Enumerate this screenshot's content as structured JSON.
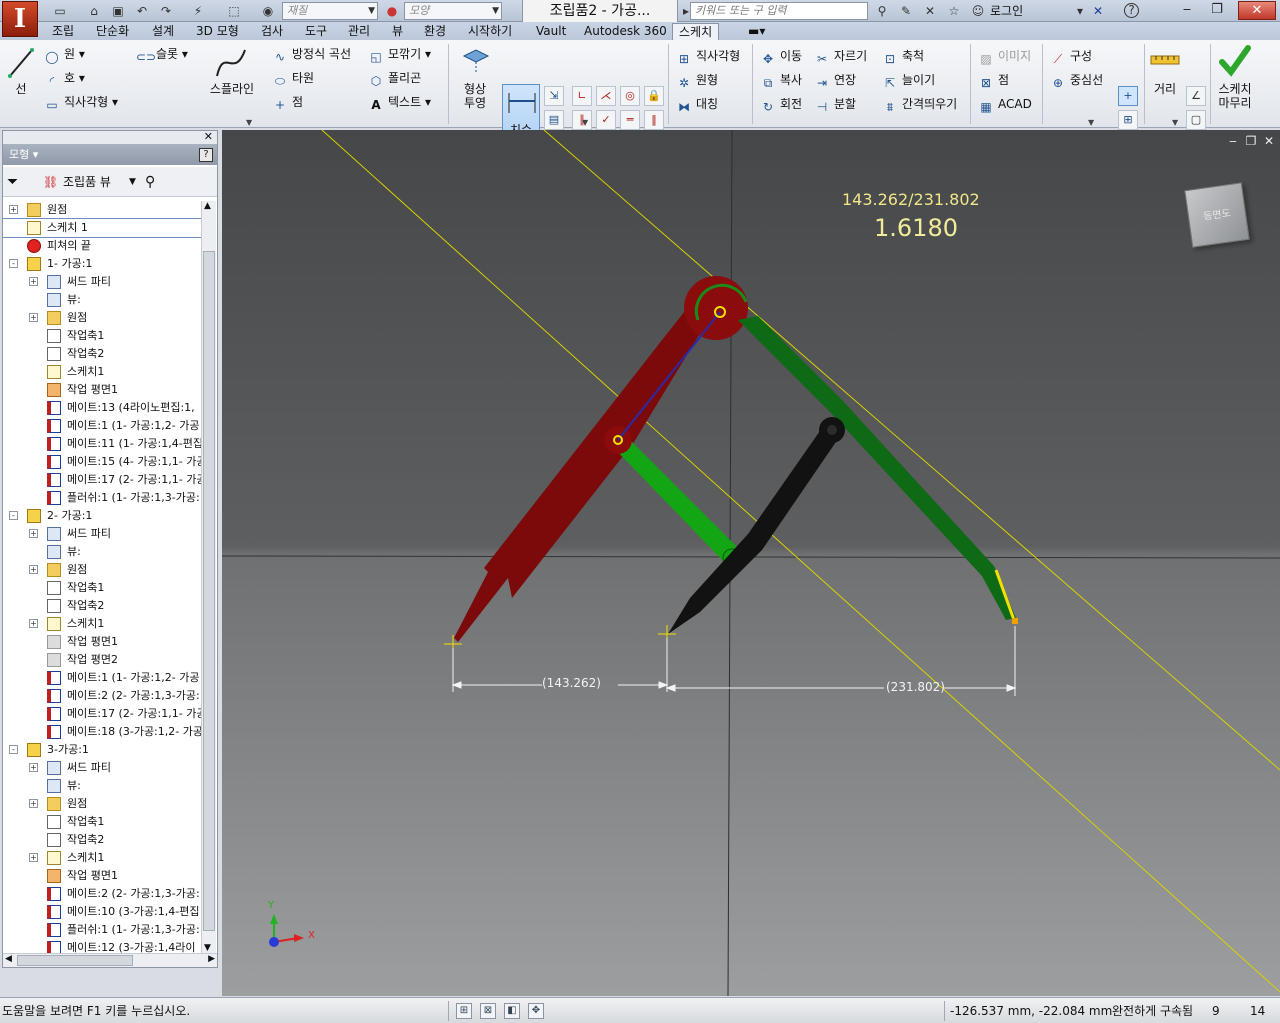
{
  "app": {
    "logo": "I",
    "doc_title": "조립품2 - 가공...",
    "material_placeholder": "재질",
    "appearance_placeholder": "모양",
    "search_placeholder": "키워드 또는 구 입력",
    "signin": "로그인",
    "help": "?"
  },
  "menu_tabs": [
    "조립",
    "단순화",
    "설계",
    "3D 모형",
    "검사",
    "도구",
    "관리",
    "뷰",
    "환경",
    "시작하기",
    "Vault",
    "Autodesk 360",
    "스케치"
  ],
  "ribbon": {
    "line": "선",
    "circle": "원",
    "arc": "호",
    "rectangle": "직사각형",
    "slot": "슬롯",
    "spline": "스플라인",
    "equation_curve": "방정식 곡선",
    "ellipse": "타원",
    "point": "점",
    "fillet": "모깎기",
    "polygon": "폴리곤",
    "text": "텍스트",
    "project": "형상\n투영",
    "dimension": "치수",
    "rect_pattern": "직사각형",
    "circ_pattern": "원형",
    "mirror": "대칭",
    "move": "이동",
    "copy": "복사",
    "rotate": "회전",
    "trim": "자르기",
    "extend": "연장",
    "split": "분할",
    "scale": "축척",
    "stretch": "늘이기",
    "offset": "간격띄우기",
    "image": "이미지",
    "points": "점",
    "acad": "ACAD",
    "construction": "구성",
    "centerline": "중심선",
    "distance": "거리",
    "finish_sketch": "스케치\n마무리"
  },
  "browser": {
    "title": "모형",
    "view": "조립품 뷰",
    "nodes": [
      {
        "label": "원점",
        "indent": 0,
        "icon": "folder",
        "expand": "+"
      },
      {
        "label": "스케치 1",
        "indent": 0,
        "icon": "sketch",
        "expand": "",
        "selected": true
      },
      {
        "label": "피쳐의 끝",
        "indent": 0,
        "icon": "end",
        "expand": ""
      },
      {
        "label": "1- 가공:1",
        "indent": 0,
        "icon": "part",
        "expand": "-"
      },
      {
        "label": "써드 파티",
        "indent": 1,
        "icon": "view",
        "expand": "+"
      },
      {
        "label": "뷰:",
        "indent": 1,
        "icon": "view",
        "expand": ""
      },
      {
        "label": "원점",
        "indent": 1,
        "icon": "folder",
        "expand": "+"
      },
      {
        "label": "작업축1",
        "indent": 1,
        "icon": "axis",
        "expand": ""
      },
      {
        "label": "작업축2",
        "indent": 1,
        "icon": "axis",
        "expand": ""
      },
      {
        "label": "스케치1",
        "indent": 1,
        "icon": "sketch",
        "expand": ""
      },
      {
        "label": "작업 평면1",
        "indent": 1,
        "icon": "plane",
        "expand": ""
      },
      {
        "label": "메이트:13 (4라이노편집:1,",
        "indent": 1,
        "icon": "mate",
        "expand": ""
      },
      {
        "label": "메이트:1 (1- 가공:1,2- 가공",
        "indent": 1,
        "icon": "mate",
        "expand": ""
      },
      {
        "label": "메이트:11 (1- 가공:1,4-편집",
        "indent": 1,
        "icon": "mate",
        "expand": ""
      },
      {
        "label": "메이트:15 (4- 가공:1,1- 가공",
        "indent": 1,
        "icon": "mate",
        "expand": ""
      },
      {
        "label": "메이트:17 (2- 가공:1,1- 가공",
        "indent": 1,
        "icon": "mate",
        "expand": ""
      },
      {
        "label": "플러쉬:1 (1- 가공:1,3-가공:",
        "indent": 1,
        "icon": "mate",
        "expand": ""
      },
      {
        "label": "2- 가공:1",
        "indent": 0,
        "icon": "part",
        "expand": "-"
      },
      {
        "label": "써드 파티",
        "indent": 1,
        "icon": "view",
        "expand": "+"
      },
      {
        "label": "뷰:",
        "indent": 1,
        "icon": "view",
        "expand": ""
      },
      {
        "label": "원점",
        "indent": 1,
        "icon": "folder",
        "expand": "+"
      },
      {
        "label": "작업축1",
        "indent": 1,
        "icon": "axis",
        "expand": ""
      },
      {
        "label": "작업축2",
        "indent": 1,
        "icon": "axis",
        "expand": ""
      },
      {
        "label": "스케치1",
        "indent": 1,
        "icon": "sketch",
        "expand": "+"
      },
      {
        "label": "작업 평면1",
        "indent": 1,
        "icon": "plane-g",
        "expand": ""
      },
      {
        "label": "작업 평면2",
        "indent": 1,
        "icon": "plane-g",
        "expand": ""
      },
      {
        "label": "메이트:1 (1- 가공:1,2- 가공",
        "indent": 1,
        "icon": "mate",
        "expand": ""
      },
      {
        "label": "메이트:2 (2- 가공:1,3-가공:",
        "indent": 1,
        "icon": "mate",
        "expand": ""
      },
      {
        "label": "메이트:17 (2- 가공:1,1- 가공",
        "indent": 1,
        "icon": "mate",
        "expand": ""
      },
      {
        "label": "메이트:18 (3-가공:1,2- 가공",
        "indent": 1,
        "icon": "mate",
        "expand": ""
      },
      {
        "label": "3-가공:1",
        "indent": 0,
        "icon": "part",
        "expand": "-"
      },
      {
        "label": "써드 파티",
        "indent": 1,
        "icon": "view",
        "expand": "+"
      },
      {
        "label": "뷰:",
        "indent": 1,
        "icon": "view",
        "expand": ""
      },
      {
        "label": "원점",
        "indent": 1,
        "icon": "folder",
        "expand": "+"
      },
      {
        "label": "작업축1",
        "indent": 1,
        "icon": "axis",
        "expand": ""
      },
      {
        "label": "작업축2",
        "indent": 1,
        "icon": "axis",
        "expand": ""
      },
      {
        "label": "스케치1",
        "indent": 1,
        "icon": "sketch",
        "expand": "+"
      },
      {
        "label": "작업 평면1",
        "indent": 1,
        "icon": "plane",
        "expand": ""
      },
      {
        "label": "메이트:2 (2- 가공:1,3-가공:",
        "indent": 1,
        "icon": "mate",
        "expand": ""
      },
      {
        "label": "메이트:10 (3-가공:1,4-편집",
        "indent": 1,
        "icon": "mate",
        "expand": ""
      },
      {
        "label": "플러쉬:1 (1- 가공:1,3-가공:",
        "indent": 1,
        "icon": "mate",
        "expand": ""
      },
      {
        "label": "메이트:12 (3-가공:1,4라이",
        "indent": 1,
        "icon": "mate",
        "expand": ""
      }
    ]
  },
  "viewport": {
    "ratio_label": "143.262/231.802",
    "golden_ratio": "1.6180",
    "dim_left": "(143.262)",
    "dim_right": "(231.802)",
    "viewcube": "등면도",
    "axis_x": "X",
    "axis_y": "Y"
  },
  "status": {
    "help": "도움말을 보려면 F1 키를 누르십시오.",
    "coords": "-126.537 mm, -22.084 mm",
    "constraint": "완전하게 구속됨",
    "count1": "9",
    "count2": "14"
  },
  "colors": {
    "red_arm": "#7d0a0a",
    "green_arm": "#0e6a14",
    "black_arm": "#121212",
    "bright_green": "#14a514",
    "guide_yellow": "#d8d200"
  }
}
